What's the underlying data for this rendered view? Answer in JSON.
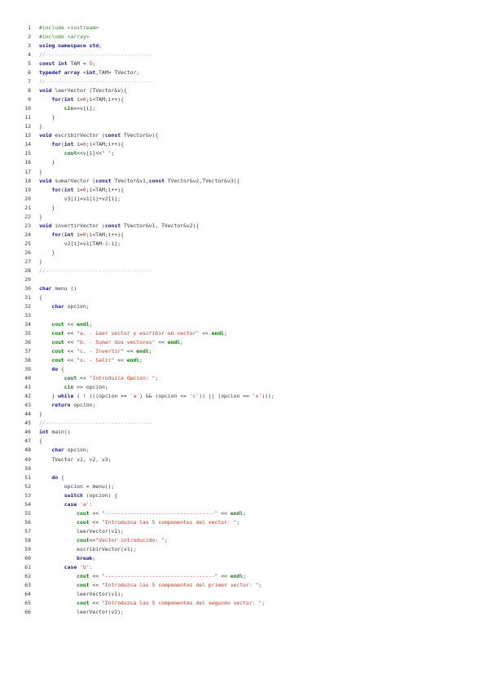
{
  "colors": {
    "keyword": "#1a1a8a",
    "preprocessor": "#2e8b2e",
    "string": "#c0392b",
    "comment": "#9a9a9a",
    "stream": "#0c7c0c",
    "text": "#333333"
  },
  "lines": [
    {
      "n": "1",
      "t": [
        [
          "pp",
          "#include <iostream>"
        ]
      ]
    },
    {
      "n": "2",
      "t": [
        [
          "pp",
          "#include <array>"
        ]
      ]
    },
    {
      "n": "3",
      "t": [
        [
          "kw",
          "using namespace std"
        ],
        [
          "tx",
          ";"
        ]
      ]
    },
    {
      "n": "4",
      "t": [
        [
          "cm",
          "//----------------------------------"
        ]
      ]
    },
    {
      "n": "5",
      "t": [
        [
          "kw",
          "const int"
        ],
        [
          "tx",
          " TAM = "
        ],
        [
          "num",
          "5"
        ],
        [
          "tx",
          ";"
        ]
      ]
    },
    {
      "n": "6",
      "t": [
        [
          "kw",
          "typedef array"
        ],
        [
          "tx",
          " <"
        ],
        [
          "kw",
          "int"
        ],
        [
          "tx",
          ",TAM> TVector;"
        ]
      ]
    },
    {
      "n": "7",
      "t": [
        [
          "cm",
          "//----------------------------------"
        ]
      ]
    },
    {
      "n": "8",
      "t": [
        [
          "kw",
          "void"
        ],
        [
          "tx",
          " leerVector (TVector&v){"
        ]
      ]
    },
    {
      "n": "9",
      "t": [
        [
          "tx",
          "    "
        ],
        [
          "kw",
          "for"
        ],
        [
          "tx",
          "("
        ],
        [
          "kw",
          "int"
        ],
        [
          "tx",
          " i="
        ],
        [
          "num",
          "0"
        ],
        [
          "tx",
          ";i<TAM;i++){"
        ]
      ]
    },
    {
      "n": "10",
      "t": [
        [
          "tx",
          "        "
        ],
        [
          "io",
          "cin"
        ],
        [
          "tx",
          ">>v[i];"
        ]
      ]
    },
    {
      "n": "11",
      "t": [
        [
          "tx",
          "    }"
        ]
      ]
    },
    {
      "n": "12",
      "t": [
        [
          "tx",
          "}"
        ]
      ]
    },
    {
      "n": "13",
      "t": [
        [
          "kw",
          "void"
        ],
        [
          "tx",
          " escribirVector ("
        ],
        [
          "kw",
          "const"
        ],
        [
          "tx",
          " TVector&v){"
        ]
      ]
    },
    {
      "n": "14",
      "t": [
        [
          "tx",
          "    "
        ],
        [
          "kw",
          "for"
        ],
        [
          "tx",
          "("
        ],
        [
          "kw",
          "int"
        ],
        [
          "tx",
          " i="
        ],
        [
          "num",
          "0"
        ],
        [
          "tx",
          ";i<TAM;i++){"
        ]
      ]
    },
    {
      "n": "15",
      "t": [
        [
          "tx",
          "        "
        ],
        [
          "io",
          "cout"
        ],
        [
          "tx",
          "<<v[i]<<"
        ],
        [
          "str",
          "\" \""
        ],
        [
          "tx",
          ";"
        ]
      ]
    },
    {
      "n": "16",
      "t": [
        [
          "tx",
          "    }"
        ]
      ]
    },
    {
      "n": "17",
      "t": [
        [
          "tx",
          "}"
        ]
      ]
    },
    {
      "n": "18",
      "t": [
        [
          "kw",
          "void"
        ],
        [
          "tx",
          " sumarVector ("
        ],
        [
          "kw",
          "const"
        ],
        [
          "tx",
          " TVector&v1,"
        ],
        [
          "kw",
          "const"
        ],
        [
          "tx",
          " TVector&v2,TVector&v3){"
        ]
      ]
    },
    {
      "n": "19",
      "t": [
        [
          "tx",
          "    "
        ],
        [
          "kw",
          "for"
        ],
        [
          "tx",
          "("
        ],
        [
          "kw",
          "int"
        ],
        [
          "tx",
          " i="
        ],
        [
          "num",
          "0"
        ],
        [
          "tx",
          ";i<TAM;i++){"
        ]
      ]
    },
    {
      "n": "20",
      "t": [
        [
          "tx",
          "        v3[i]=v1[i]+v2[i];"
        ]
      ]
    },
    {
      "n": "21",
      "t": [
        [
          "tx",
          "    }"
        ]
      ]
    },
    {
      "n": "22",
      "t": [
        [
          "tx",
          "}"
        ]
      ]
    },
    {
      "n": "23",
      "t": [
        [
          "kw",
          "void"
        ],
        [
          "tx",
          " invertirVector ("
        ],
        [
          "kw",
          "const"
        ],
        [
          "tx",
          " TVector&v1, TVector&v2){"
        ]
      ]
    },
    {
      "n": "24",
      "t": [
        [
          "tx",
          "    "
        ],
        [
          "kw",
          "for"
        ],
        [
          "tx",
          "("
        ],
        [
          "kw",
          "int"
        ],
        [
          "tx",
          " i="
        ],
        [
          "num",
          "0"
        ],
        [
          "tx",
          ";i<TAM;i++){"
        ]
      ]
    },
    {
      "n": "25",
      "t": [
        [
          "tx",
          "        v2[i]=v1[TAM-"
        ],
        [
          "num",
          "1"
        ],
        [
          "tx",
          "-i];"
        ]
      ]
    },
    {
      "n": "26",
      "t": [
        [
          "tx",
          "    }"
        ]
      ]
    },
    {
      "n": "27",
      "t": [
        [
          "tx",
          "}"
        ]
      ]
    },
    {
      "n": "28",
      "t": [
        [
          "cm",
          "//----------------------------------"
        ]
      ]
    },
    {
      "n": "29",
      "t": []
    },
    {
      "n": "30",
      "t": [
        [
          "kw",
          "char"
        ],
        [
          "tx",
          " menu ()"
        ]
      ]
    },
    {
      "n": "31",
      "t": [
        [
          "tx",
          "{"
        ]
      ]
    },
    {
      "n": "32",
      "t": [
        [
          "tx",
          "    "
        ],
        [
          "kw",
          "char"
        ],
        [
          "tx",
          " opcion;"
        ]
      ]
    },
    {
      "n": "33",
      "t": []
    },
    {
      "n": "34",
      "t": [
        [
          "tx",
          "    "
        ],
        [
          "io",
          "cout"
        ],
        [
          "tx",
          " << "
        ],
        [
          "io",
          "endl"
        ],
        [
          "tx",
          ";"
        ]
      ]
    },
    {
      "n": "35",
      "t": [
        [
          "tx",
          "    "
        ],
        [
          "io",
          "cout"
        ],
        [
          "tx",
          " << "
        ],
        [
          "str",
          "\"a. - Leer vector y escribir un vector\""
        ],
        [
          "tx",
          " << "
        ],
        [
          "io",
          "endl"
        ],
        [
          "tx",
          ";"
        ]
      ]
    },
    {
      "n": "36",
      "t": [
        [
          "tx",
          "    "
        ],
        [
          "io",
          "cout"
        ],
        [
          "tx",
          " << "
        ],
        [
          "str",
          "\"b. - Sumar dos vectores\""
        ],
        [
          "tx",
          " << "
        ],
        [
          "io",
          "endl"
        ],
        [
          "tx",
          ";"
        ]
      ]
    },
    {
      "n": "37",
      "t": [
        [
          "tx",
          "    "
        ],
        [
          "io",
          "cout"
        ],
        [
          "tx",
          " << "
        ],
        [
          "str",
          "\"c. - Invertir\""
        ],
        [
          "tx",
          " << "
        ],
        [
          "io",
          "endl"
        ],
        [
          "tx",
          ";"
        ]
      ]
    },
    {
      "n": "38",
      "t": [
        [
          "tx",
          "    "
        ],
        [
          "io",
          "cout"
        ],
        [
          "tx",
          " << "
        ],
        [
          "str",
          "\"x. - Salir\""
        ],
        [
          "tx",
          " << "
        ],
        [
          "io",
          "endl"
        ],
        [
          "tx",
          ";"
        ]
      ]
    },
    {
      "n": "39",
      "t": [
        [
          "tx",
          "    "
        ],
        [
          "kw",
          "do"
        ],
        [
          "tx",
          " {"
        ]
      ]
    },
    {
      "n": "40",
      "t": [
        [
          "tx",
          "        "
        ],
        [
          "io",
          "cout"
        ],
        [
          "tx",
          " << "
        ],
        [
          "str",
          "\"Introduzca Opcion: \""
        ],
        [
          "tx",
          ";"
        ]
      ]
    },
    {
      "n": "41",
      "t": [
        [
          "tx",
          "        "
        ],
        [
          "io",
          "cin"
        ],
        [
          "tx",
          " >> opcion;"
        ]
      ]
    },
    {
      "n": "42",
      "t": [
        [
          "tx",
          "    } "
        ],
        [
          "kw",
          "while"
        ],
        [
          "tx",
          " ( ! (((opcion >= "
        ],
        [
          "str",
          "'a'"
        ],
        [
          "tx",
          ") && (opcion <= "
        ],
        [
          "str",
          "'c'"
        ],
        [
          "tx",
          ")) || (opcion == "
        ],
        [
          "str",
          "'x'"
        ],
        [
          "tx",
          ")));"
        ]
      ]
    },
    {
      "n": "43",
      "t": [
        [
          "tx",
          "    "
        ],
        [
          "kw",
          "return"
        ],
        [
          "tx",
          " opcion;"
        ]
      ]
    },
    {
      "n": "44",
      "t": [
        [
          "tx",
          "}"
        ]
      ]
    },
    {
      "n": "45",
      "t": [
        [
          "cm",
          "//----------------------------------"
        ]
      ]
    },
    {
      "n": "46",
      "t": [
        [
          "kw",
          "int"
        ],
        [
          "tx",
          " main()"
        ]
      ]
    },
    {
      "n": "47",
      "t": [
        [
          "tx",
          "{"
        ]
      ]
    },
    {
      "n": "48",
      "t": [
        [
          "tx",
          "    "
        ],
        [
          "kw",
          "char"
        ],
        [
          "tx",
          " opcion;"
        ]
      ]
    },
    {
      "n": "49",
      "t": [
        [
          "tx",
          "    TVector v1, v2, v3;"
        ]
      ]
    },
    {
      "n": "50",
      "t": []
    },
    {
      "n": "51",
      "t": [
        [
          "tx",
          "    "
        ],
        [
          "kw",
          "do"
        ],
        [
          "tx",
          " {"
        ]
      ]
    },
    {
      "n": "52",
      "t": [
        [
          "tx",
          "        opcion = menu();"
        ]
      ]
    },
    {
      "n": "53",
      "t": [
        [
          "tx",
          "        "
        ],
        [
          "kw",
          "switch"
        ],
        [
          "tx",
          " (opcion) {"
        ]
      ]
    },
    {
      "n": "54",
      "t": [
        [
          "tx",
          "        "
        ],
        [
          "kw",
          "case"
        ],
        [
          "tx",
          " "
        ],
        [
          "str",
          "'a'"
        ],
        [
          "tx",
          ":"
        ]
      ]
    },
    {
      "n": "55",
      "t": [
        [
          "tx",
          "            "
        ],
        [
          "io",
          "cout"
        ],
        [
          "tx",
          " << "
        ],
        [
          "str",
          "\"-----------------------------------\""
        ],
        [
          "tx",
          " << "
        ],
        [
          "io",
          "endl"
        ],
        [
          "tx",
          ";"
        ]
      ]
    },
    {
      "n": "56",
      "t": [
        [
          "tx",
          "            "
        ],
        [
          "io",
          "cout"
        ],
        [
          "tx",
          " << "
        ],
        [
          "str",
          "\"Introduzca las 5 componentes del vector: \""
        ],
        [
          "tx",
          ";"
        ]
      ]
    },
    {
      "n": "57",
      "t": [
        [
          "tx",
          "            leerVector(v1);"
        ]
      ]
    },
    {
      "n": "58",
      "t": [
        [
          "tx",
          "            "
        ],
        [
          "io",
          "cout"
        ],
        [
          "tx",
          "<<"
        ],
        [
          "str",
          "\"Vector introducido: \""
        ],
        [
          "tx",
          ";"
        ]
      ]
    },
    {
      "n": "59",
      "t": [
        [
          "tx",
          "            escribirVector(v1);"
        ]
      ]
    },
    {
      "n": "60",
      "t": [
        [
          "tx",
          "            "
        ],
        [
          "kw",
          "break"
        ],
        [
          "tx",
          ";"
        ]
      ]
    },
    {
      "n": "61",
      "t": [
        [
          "tx",
          "        "
        ],
        [
          "kw",
          "case"
        ],
        [
          "tx",
          " "
        ],
        [
          "str",
          "'b'"
        ],
        [
          "tx",
          ":"
        ]
      ]
    },
    {
      "n": "62",
      "t": [
        [
          "tx",
          "            "
        ],
        [
          "io",
          "cout"
        ],
        [
          "tx",
          " << "
        ],
        [
          "str",
          "\"-----------------------------------\""
        ],
        [
          "tx",
          " << "
        ],
        [
          "io",
          "endl"
        ],
        [
          "tx",
          ";"
        ]
      ]
    },
    {
      "n": "63",
      "t": [
        [
          "tx",
          "            "
        ],
        [
          "io",
          "cout"
        ],
        [
          "tx",
          " << "
        ],
        [
          "str",
          "\"Introduzca las 5 componentes del primer vector: \""
        ],
        [
          "tx",
          ";"
        ]
      ]
    },
    {
      "n": "64",
      "t": [
        [
          "tx",
          "            leerVector(v1);"
        ]
      ]
    },
    {
      "n": "65",
      "t": [
        [
          "tx",
          "            "
        ],
        [
          "io",
          "cout"
        ],
        [
          "tx",
          " << "
        ],
        [
          "str",
          "\"Introduzca las 5 componentes del segundo vector: \""
        ],
        [
          "tx",
          ";"
        ]
      ]
    },
    {
      "n": "66",
      "t": [
        [
          "tx",
          "            leerVector(v2);"
        ]
      ]
    }
  ]
}
